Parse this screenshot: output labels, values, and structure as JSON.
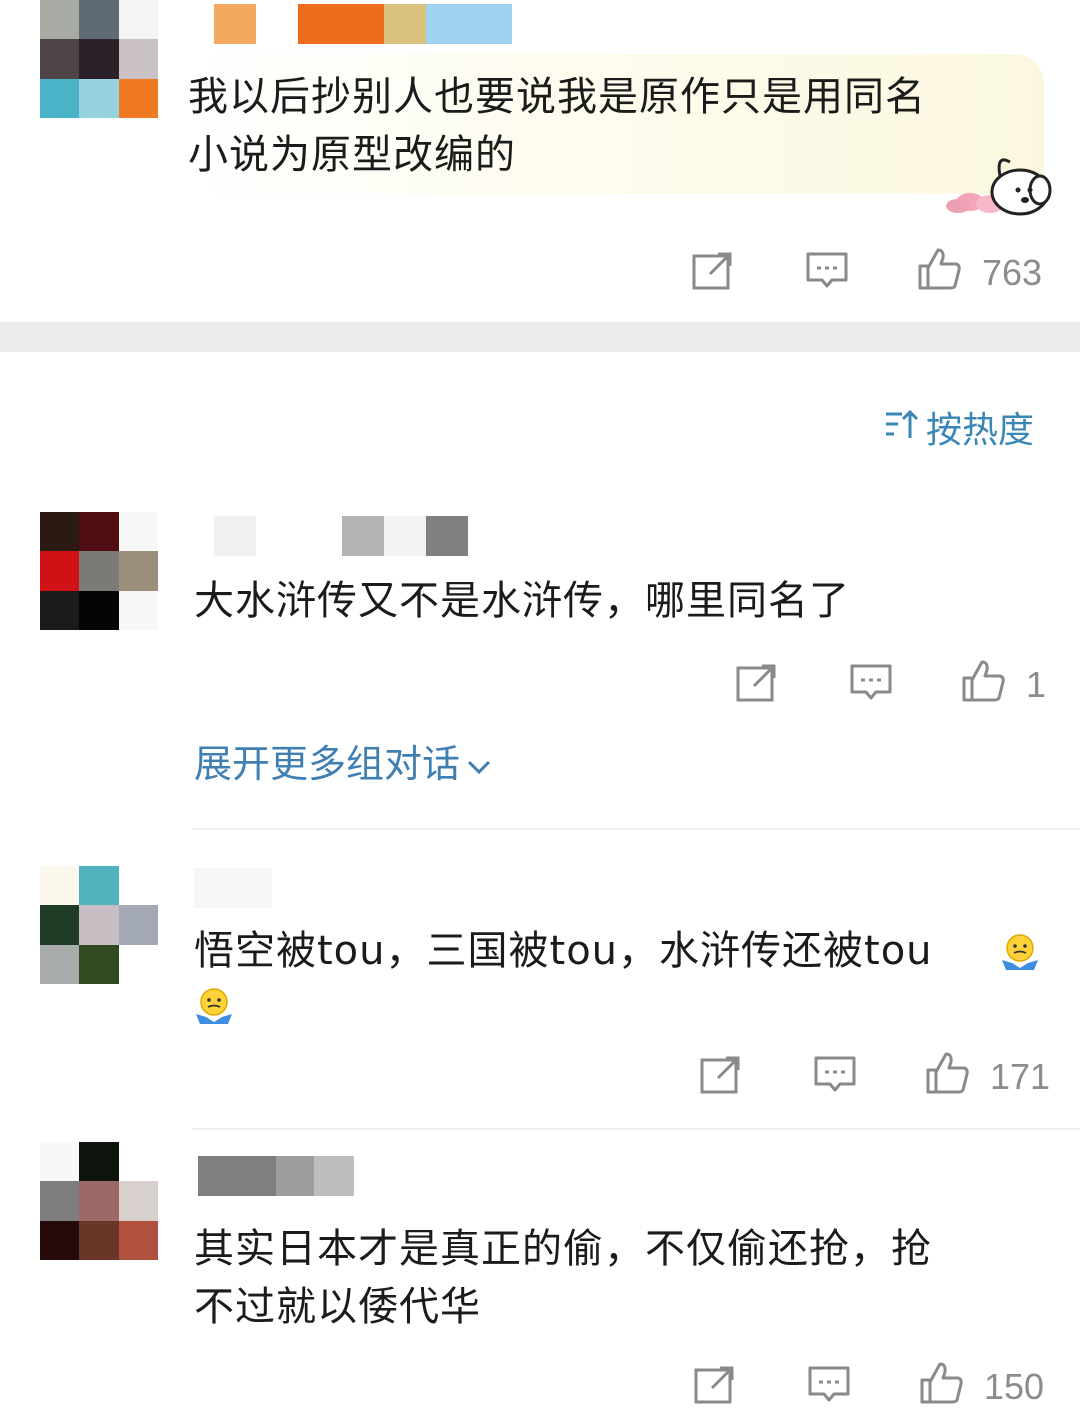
{
  "comments": [
    {
      "text_line1": "我以后抄别人也要说我是原作只是用同名",
      "text_line2": "小说为原型改编的",
      "likes": "763"
    },
    {
      "text_line1": "大水浒传又不是水浒传，哪里同名了",
      "likes": "1"
    },
    {
      "text_line1": "悟空被tou，三国被tou，水浒传还被tou",
      "likes": "171"
    },
    {
      "text_line1": "其实日本才是真正的偷，不仅偷还抢，抢",
      "text_line2": "不过就以倭代华",
      "likes": "150"
    }
  ],
  "sort": {
    "label": "按热度",
    "icon": "sort-icon"
  },
  "expand": {
    "label": "展开更多组对话",
    "icon": "chevron-down-icon"
  },
  "icons": {
    "share": "share-icon",
    "reply": "comment-icon",
    "like": "thumbs-up-icon"
  },
  "colors": {
    "link": "#3f7fb2",
    "muted": "#8c8c8c",
    "separator": "#ececec"
  }
}
